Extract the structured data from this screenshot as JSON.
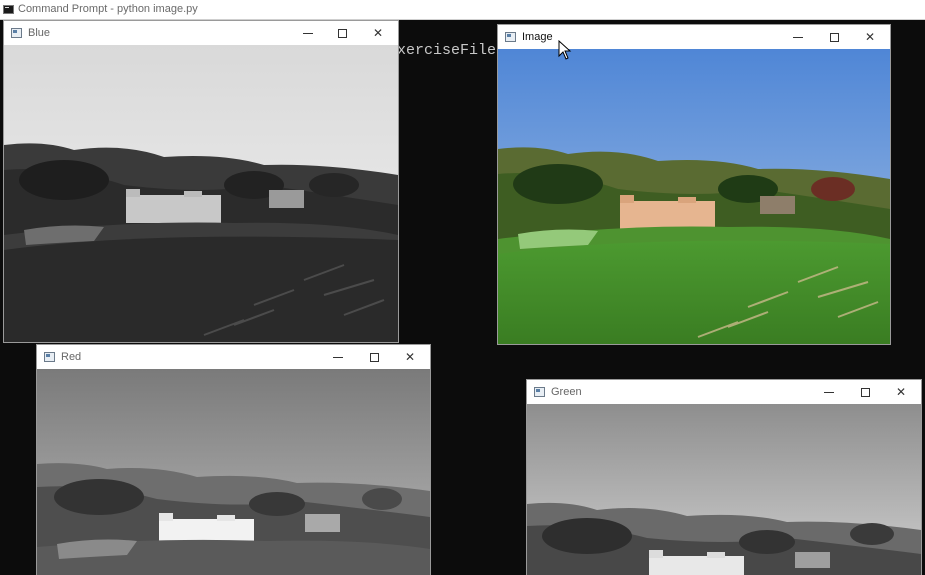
{
  "cmd": {
    "title": "Command Prompt - python  image.py",
    "line1_prefix": "(",
    "line1_tail": "xerciseFiles",
    "line2_prefix": "["
  },
  "windows": {
    "blue": {
      "title": "Blue",
      "channel": "grayscale"
    },
    "image": {
      "title": "Image",
      "channel": "color"
    },
    "red": {
      "title": "Red",
      "channel": "grayscale"
    },
    "green": {
      "title": "Green",
      "channel": "grayscale"
    }
  },
  "controls": {
    "minimize_icon": "minimize-icon",
    "maximize_icon": "maximize-icon",
    "close_icon": "close-icon"
  },
  "colors": {
    "console_bg": "#0c0c0c",
    "sky_color": "#5b8fd6",
    "grass_color": "#3f8a2c"
  }
}
